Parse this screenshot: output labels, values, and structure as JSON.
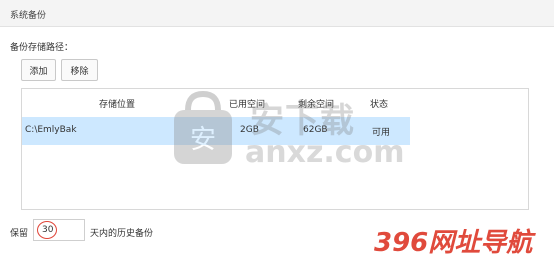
{
  "header": {
    "title": "系统备份"
  },
  "backup_path": {
    "label": "备份存储路径："
  },
  "buttons": {
    "add": "添加",
    "remove": "移除"
  },
  "table": {
    "columns": [
      "存储位置",
      "已用空间",
      "剩余空间",
      "状态"
    ],
    "rows": [
      {
        "path": "C:\\EmlyBak",
        "used": "2GB",
        "free": "62GB",
        "status": "可用"
      }
    ]
  },
  "retention": {
    "prefix": "保留",
    "value": "30",
    "suffix": "天内的历史备份"
  },
  "watermark": {
    "cn_text": "安下载",
    "url_text": "anxz.com",
    "logo_char": "安",
    "brand": "396网址导航"
  },
  "colors": {
    "selected_row": "#cde8ff",
    "highlight_circle": "#e0463a",
    "brand_red": "#e04a3c"
  }
}
